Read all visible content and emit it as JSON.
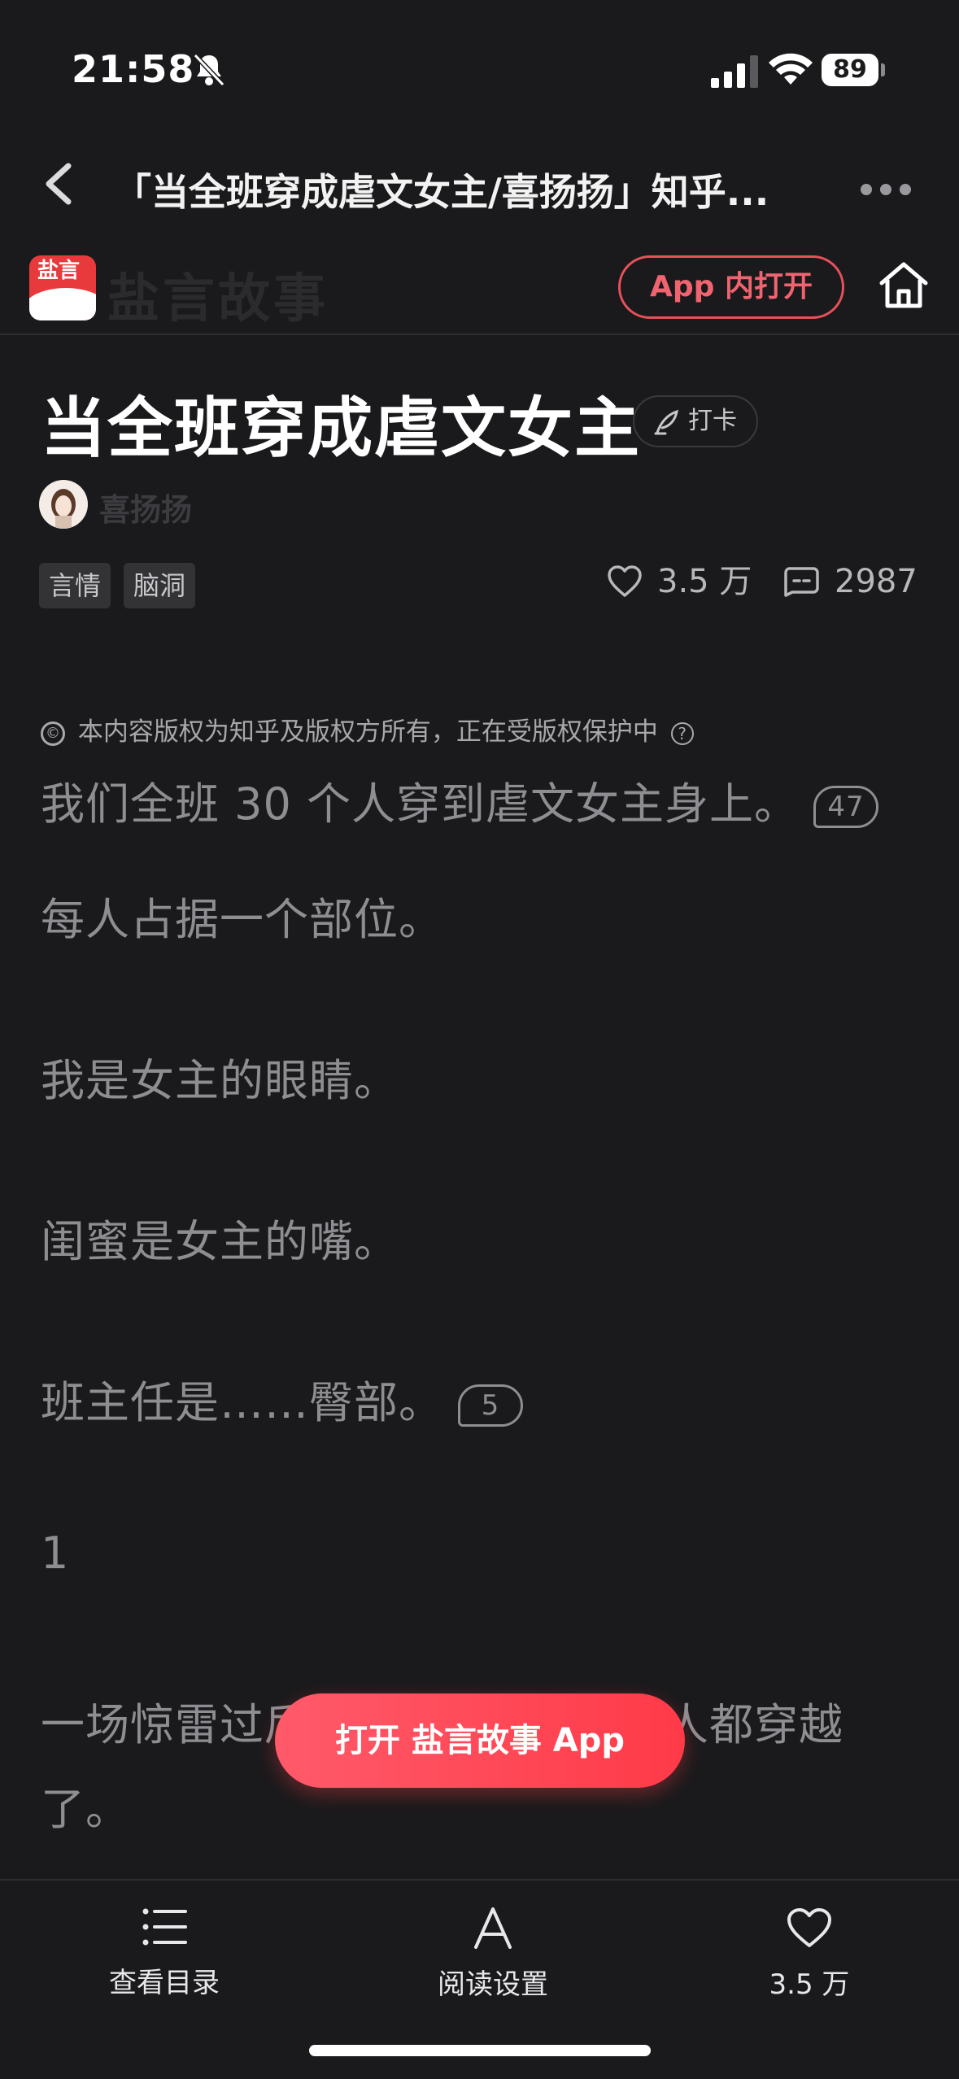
{
  "status_bar": {
    "time": "21:58",
    "battery": "89",
    "icons": [
      "bell-slash-icon",
      "signal-icon",
      "wifi-icon",
      "battery-icon"
    ]
  },
  "nav": {
    "title": "「当全班穿成虐文女主/喜扬扬」知乎...",
    "back_icon": "chevron-left-icon",
    "more_icon": "ellipsis-icon"
  },
  "site_header": {
    "logo_text": "盐言故事",
    "logo_mark": "盐言",
    "open_in_app": "App 内打开",
    "home_icon": "home-icon"
  },
  "article": {
    "title": "当全班穿成虐文女主",
    "checkin_label": "打卡",
    "author": "喜扬扬",
    "tags": [
      "言情",
      "脑洞"
    ],
    "likes": "3.5 万",
    "comments": "2987",
    "copyright": "本内容版权为知乎及版权方所有，正在受版权保护中",
    "copyright_icon_glyph": "©",
    "help_glyph": "?"
  },
  "content": {
    "p1": "我们全班 30 个人穿到虐文女主身上。",
    "p1_comments": "47",
    "p2": "每人占据一个部位。",
    "p3": "我是女主的眼睛。",
    "p4": "闺蜜是女主的嘴。",
    "p5": "班主任是……臀部。",
    "p5_comments": "5",
    "p6": "1",
    "p7a": "一场惊雷过后，我们全班 30 个人都穿越",
    "p7b": "了。"
  },
  "cta": {
    "label": "打开 盐言故事 App"
  },
  "bottom_bar": {
    "toc": "查看目录",
    "reading_settings": "阅读设置",
    "likes": "3.5 万"
  },
  "colors": {
    "background": "#1a1a1c",
    "accent": "#ff3a48",
    "text_dim": "#8e8e92"
  }
}
